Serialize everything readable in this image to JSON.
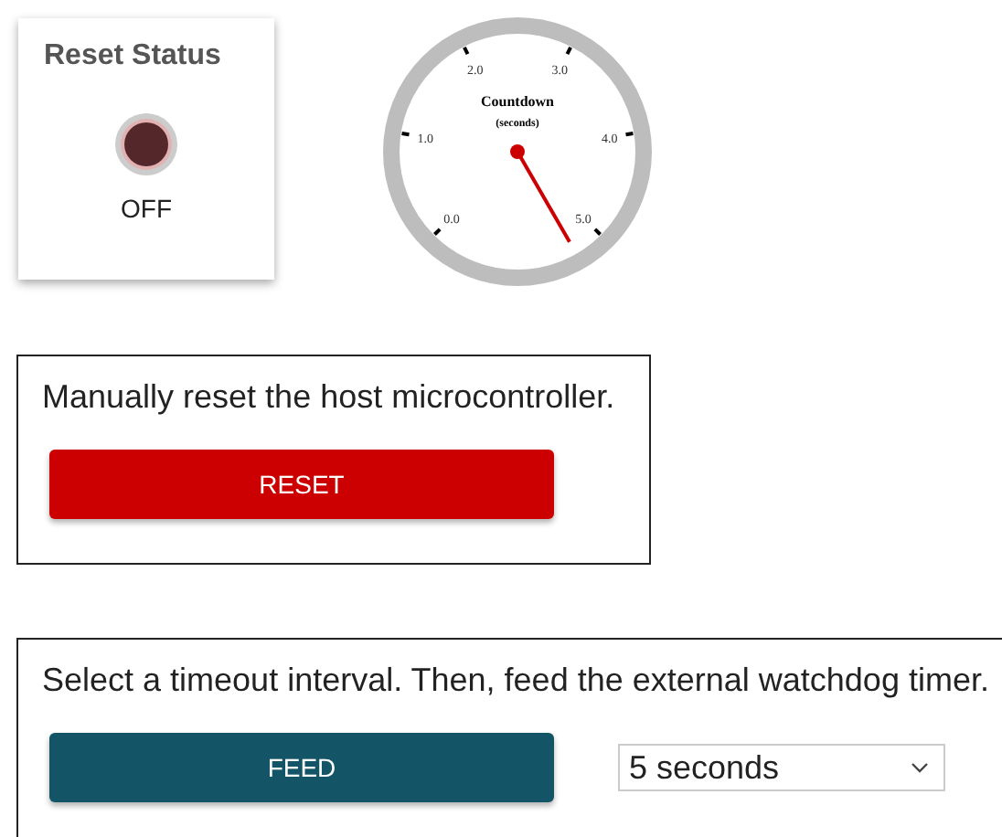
{
  "status_card": {
    "title": "Reset Status",
    "on": false,
    "label": "OFF"
  },
  "gauge": {
    "title": "Countdown",
    "subtitle": "(seconds)",
    "tick_labels": [
      "0.0",
      "1.0",
      "2.0",
      "3.0",
      "4.0",
      "5.0"
    ]
  },
  "reset_panel": {
    "text": "Manually reset the host microcontroller.",
    "button": "RESET"
  },
  "feed_panel": {
    "text": "Select a timeout interval. Then, feed the external watchdog timer.",
    "button": "FEED",
    "interval": "5 seconds"
  }
}
